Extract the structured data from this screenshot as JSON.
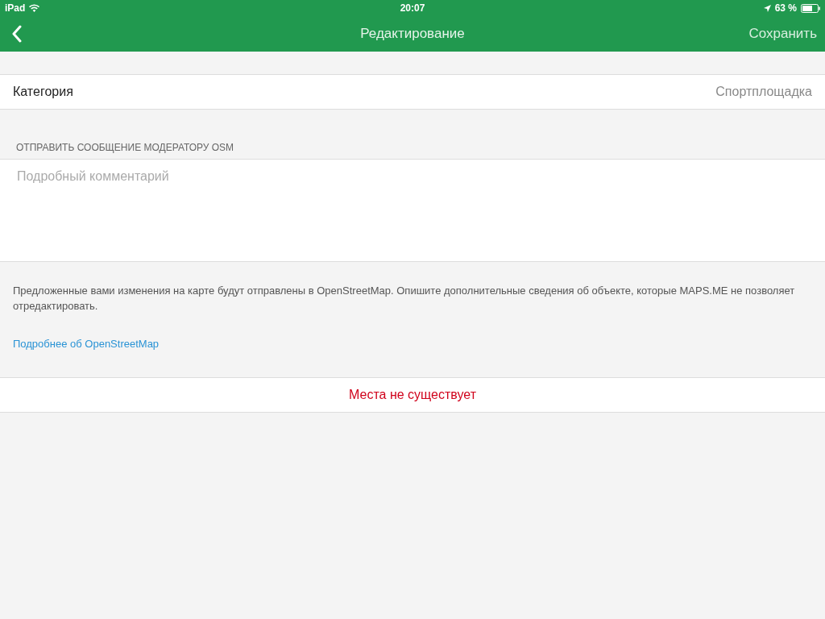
{
  "status_bar": {
    "device": "iPad",
    "time": "20:07",
    "battery": "63 %"
  },
  "nav_bar": {
    "title": "Редактирование",
    "action": "Сохранить"
  },
  "category": {
    "label": "Категория",
    "value": "Спортплощадка"
  },
  "message": {
    "header": "ОТПРАВИТЬ СООБЩЕНИЕ МОДЕРАТОРУ OSM",
    "placeholder": "Подробный комментарий"
  },
  "note": {
    "text": "Предложенные вами изменения на карте будут отправлены в OpenStreetMap. Опишите дополнительные сведения об объекте, которые MAPS.ME не позволяет отредактировать.",
    "link": "Подробнее об OpenStreetMap"
  },
  "delete_button": "Места не существует"
}
